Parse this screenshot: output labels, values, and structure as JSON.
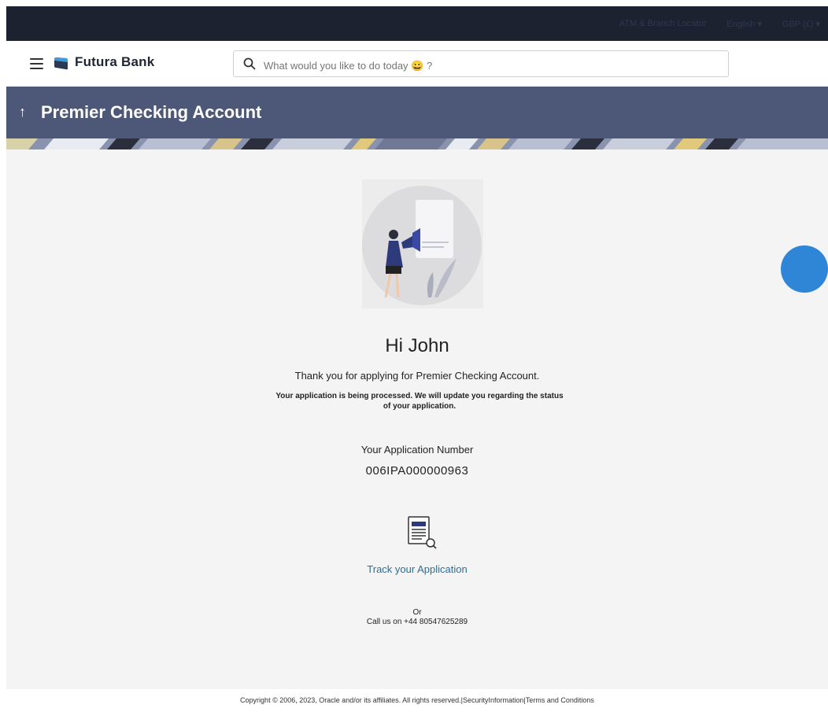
{
  "topbar": {
    "branch": "ATM & Branch Locator",
    "language": "English",
    "currency": "GBP (£)"
  },
  "header": {
    "brand": "Futura Bank",
    "search_placeholder": "What would you like to do today 😀 ?"
  },
  "page": {
    "title": "Premier Checking Account",
    "back_icon": "↑"
  },
  "main": {
    "greeting": "Hi John",
    "thanks": "Thank you for applying for Premier Checking Account.",
    "processed": "Your application is being processed. We will update you regarding the status of your application.",
    "app_label": "Your Application Number",
    "app_number": "006IPA000000963",
    "track_link": "Track your Application",
    "or": "Or",
    "call": "Call us on +44 80547625289"
  },
  "footer": {
    "copyright": "Copyright © 2006, 2023, Oracle and/or its affiliates. All rights reserved.",
    "security": "SecurityInformation",
    "terms": "Terms and Conditions"
  },
  "colors": {
    "topbar": "#1c2230",
    "titlebar": "#4d5778",
    "link": "#2b6f95",
    "fab": "#2f86d6"
  }
}
